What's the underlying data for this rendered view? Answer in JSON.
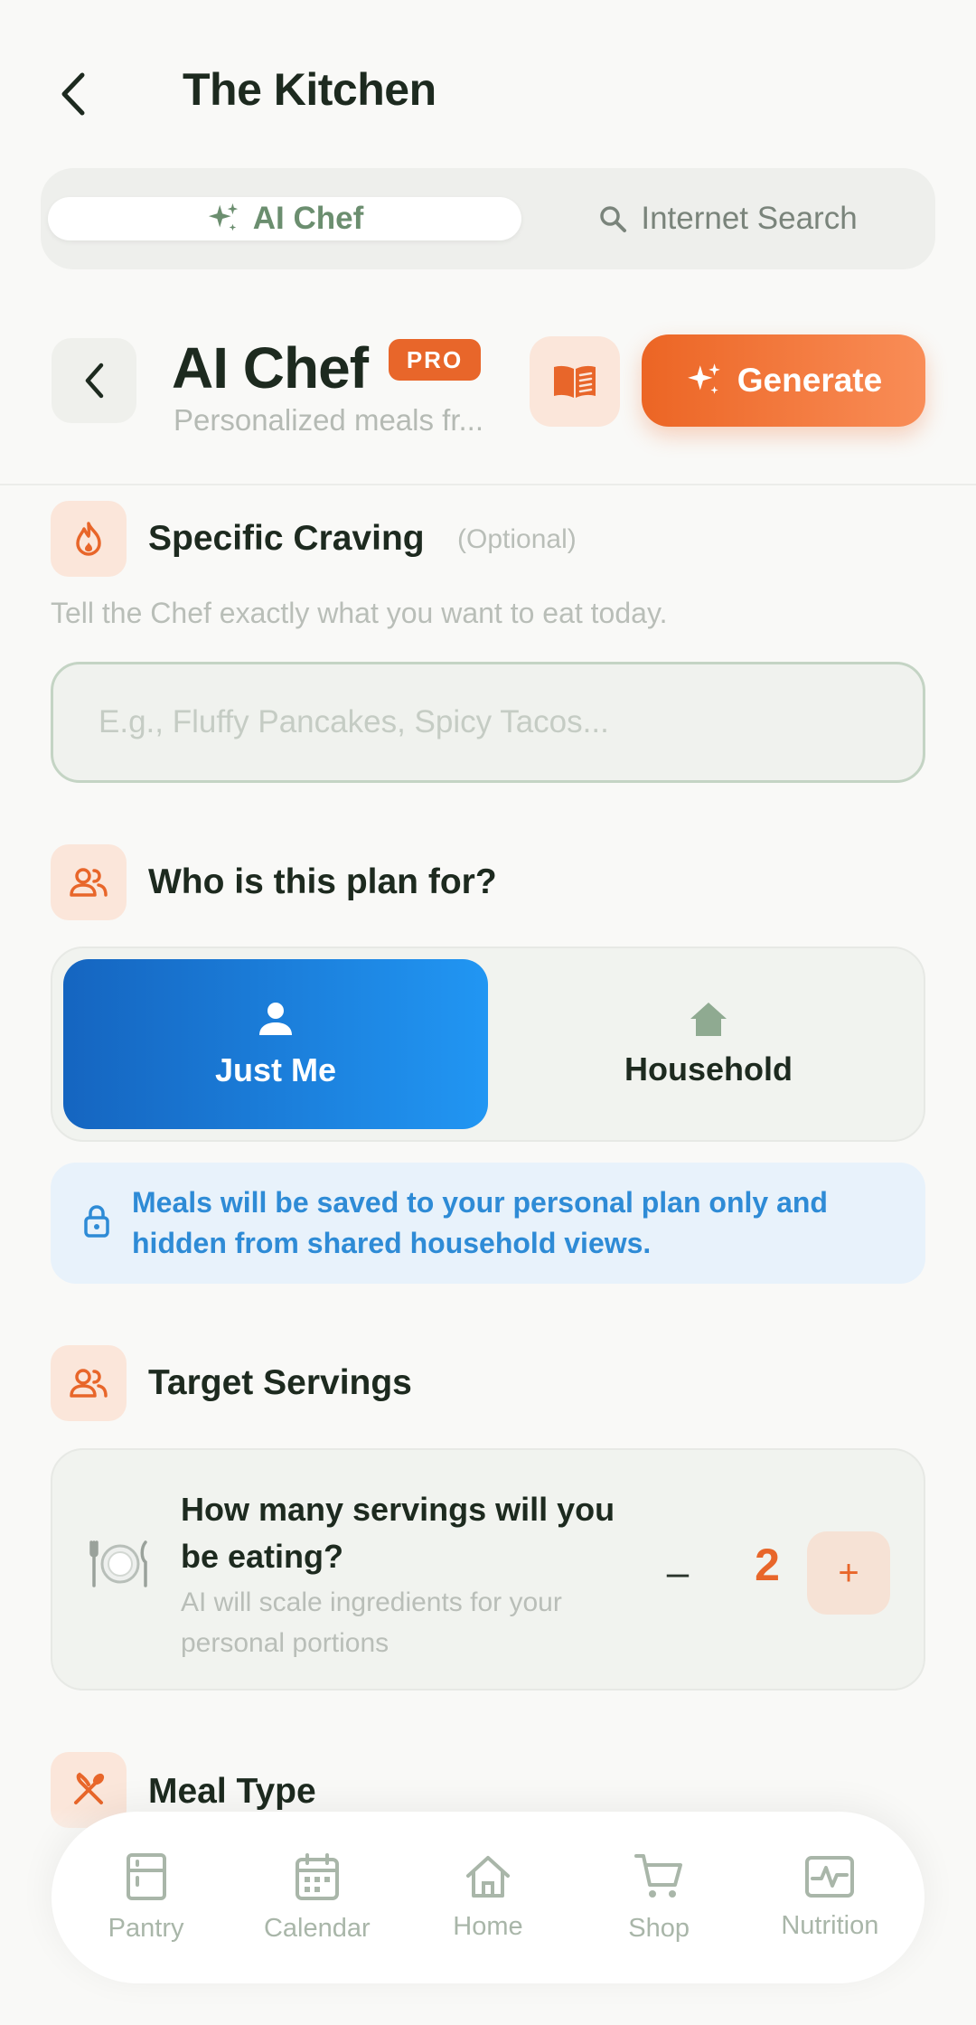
{
  "header": {
    "title": "The Kitchen"
  },
  "mode_tabs": {
    "ai_chef": "AI Chef",
    "internet_search": "Internet Search"
  },
  "chef": {
    "title": "AI Chef",
    "badge": "PRO",
    "subtitle": "Personalized meals fr...",
    "generate_label": "Generate"
  },
  "craving": {
    "title": "Specific Craving",
    "optional": "(Optional)",
    "description": "Tell the Chef exactly what you want to eat today.",
    "placeholder": "E.g., Fluffy Pancakes, Spicy Tacos...",
    "value": ""
  },
  "plan_for": {
    "title": "Who is this plan for?",
    "options": [
      "Just Me",
      "Household"
    ],
    "selected": "Just Me",
    "notice": "Meals will be saved to your personal plan only and hidden from shared household views."
  },
  "servings": {
    "title": "Target Servings",
    "question": "How many servings will you be eating?",
    "subtext": "AI will scale ingredients for your personal portions",
    "count": "2",
    "minus_label": "–",
    "plus_label": "+"
  },
  "meal_type": {
    "title": "Meal Type"
  },
  "nav": {
    "items": [
      "Pantry",
      "Calendar",
      "Home",
      "Shop",
      "Nutrition"
    ]
  },
  "colors": {
    "accent_orange": "#e8662a",
    "primary_blue": "#1e88e5",
    "sage_green": "#6b8e6f",
    "background": "#f9f9f7"
  }
}
